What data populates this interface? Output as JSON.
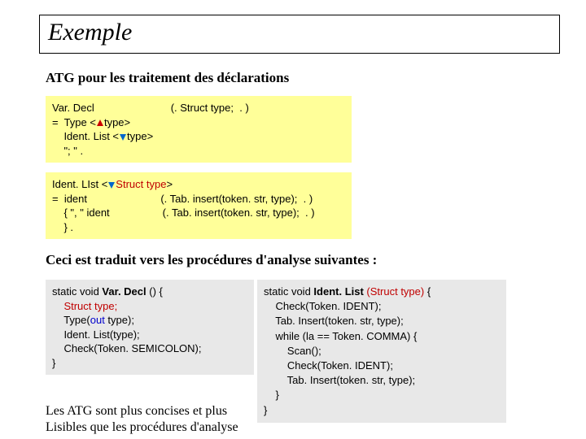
{
  "title": "Exemple",
  "subtitle": "ATG pour les traitement des déclarations",
  "atg1": {
    "l1a": "Var. Decl",
    "l1b": "(. Struct type;  . )",
    "l2a": "=  Type <",
    "l2b": "type>",
    "l3a": "    Ident. List <",
    "l3b": "type>",
    "l4": "    \"; \" ."
  },
  "atg2": {
    "l1a": "Ident. LIst <",
    "l1b": "Struct type",
    "l1c": ">",
    "l2a": "=  ident",
    "l2b": "(. Tab. insert(token. str, type);  . )",
    "l3a": "    { \", \" ident",
    "l3b": "(. Tab. insert(token. str, type);  . )",
    "l4": "    } ."
  },
  "midtext": "Ceci est traduit vers les procédures d'analyse suivantes :",
  "code1": {
    "l1a": "static void ",
    "l1b": "Var. Decl ",
    "l1c": "() {",
    "l2": "    Struct type;",
    "l3a": "    Type(",
    "l3b": "out ",
    "l3c": "type);",
    "l4": "    Ident. List(type);",
    "l5": "    Check(Token. SEMICOLON);",
    "l6": "}"
  },
  "code2": {
    "l1a": "static void ",
    "l1b": "Ident. List ",
    "l1c": "(Struct type) ",
    "l1d": "{",
    "l2": "    Check(Token. IDENT);",
    "l3": "    Tab. Insert(token. str, type);",
    "l4": "    while (la == Token. COMMA) {",
    "l5": "        Scan();",
    "l6": "        Check(Token. IDENT);",
    "l7": "        Tab. Insert(token. str, type);",
    "l8": "    }",
    "l9": "}"
  },
  "footer1": "Les ATG sont plus concises et plus",
  "footer2": "Lisibles que les procédures d'analyse"
}
